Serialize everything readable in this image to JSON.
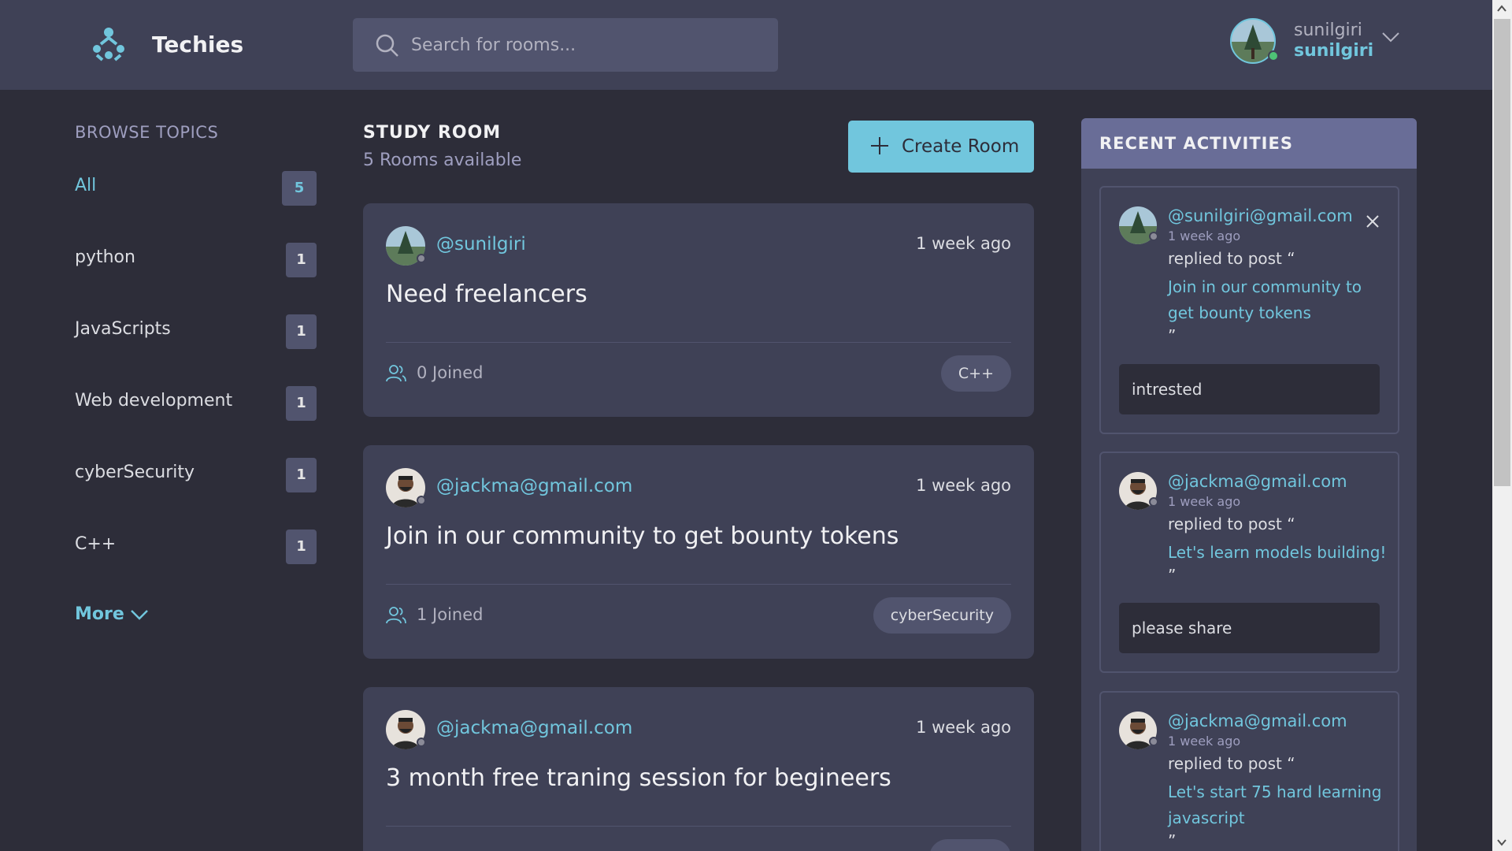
{
  "header": {
    "brand": "Techies",
    "search_placeholder": "Search for rooms...",
    "user_name": "sunilgiri",
    "user_handle": "sunilgiri"
  },
  "sidebar": {
    "title": "BROWSE TOPICS",
    "topics": [
      {
        "label": "All",
        "count": "5"
      },
      {
        "label": "python",
        "count": "1"
      },
      {
        "label": "JavaScripts",
        "count": "1"
      },
      {
        "label": "Web development",
        "count": "1"
      },
      {
        "label": "cyberSecurity",
        "count": "1"
      },
      {
        "label": "C++",
        "count": "1"
      }
    ],
    "more_label": "More"
  },
  "main": {
    "title": "STUDY ROOM",
    "rooms_available": "5 Rooms available",
    "create_label": "Create Room",
    "rooms": [
      {
        "host": "@sunilgiri",
        "time": "1 week ago",
        "title": "Need freelancers",
        "joined": "0 Joined",
        "tag": "C++"
      },
      {
        "host": "@jackma@gmail.com",
        "time": "1 week ago",
        "title": "Join in our community to get bounty tokens",
        "joined": "1 Joined",
        "tag": "cyberSecurity"
      },
      {
        "host": "@jackma@gmail.com",
        "time": "1 week ago",
        "title": "3 month free traning session for begineers",
        "joined": "",
        "tag": ""
      }
    ]
  },
  "activities": {
    "title": "RECENT ACTIVITIES",
    "items": [
      {
        "user": "@sunilgiri@gmail.com",
        "time": "1 week ago",
        "replied": "replied to post “",
        "post": "Join in our community to get bounty tokens",
        "close_quote": "”",
        "comment": "intrested"
      },
      {
        "user": "@jackma@gmail.com",
        "time": "1 week ago",
        "replied": "replied to post “",
        "post": "Let's learn models building!",
        "close_quote": "”",
        "comment": "please share"
      },
      {
        "user": "@jackma@gmail.com",
        "time": "1 week ago",
        "replied": "replied to post “",
        "post": "Let's start 75 hard learning javascript",
        "close_quote": "”",
        "comment": ""
      }
    ]
  },
  "colors": {
    "background": "#2d2d39",
    "surface": "#3f4156",
    "accent": "#71c6dd",
    "activities_header": "#696d97"
  }
}
